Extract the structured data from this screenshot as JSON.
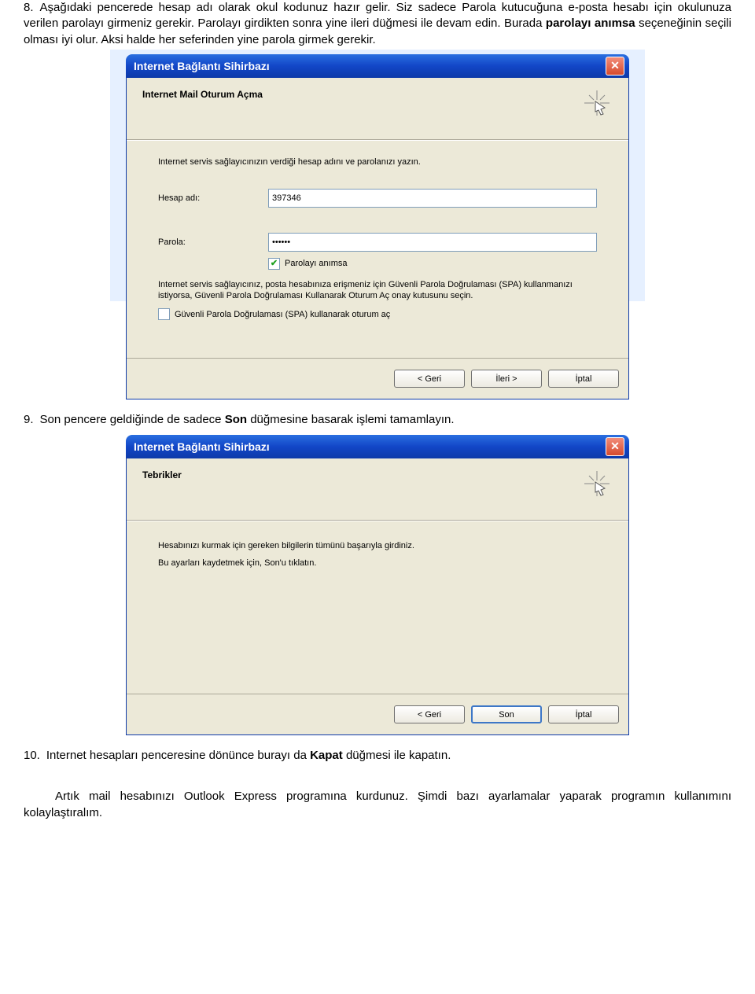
{
  "text": {
    "p8_num": "8.",
    "p8": "Aşağıdaki pencerede hesap adı olarak okul kodunuz hazır gelir. Siz sadece Parola kutucuğuna e-posta hesabı için okulunuza verilen parolayı girmeniz gerekir. Parolayı girdikten sonra yine ileri düğmesi ile devam edin. Burada ",
    "p8_bold1": "parolayı anımsa",
    "p8_cont": " seçeneğinin seçili olması iyi olur. Aksi halde her seferinden yine parola girmek gerekir.",
    "p9_num": "9.",
    "p9_a": "Son pencere geldiğinde de sadece ",
    "p9_bold": "Son",
    "p9_b": " düğmesine basarak işlemi tamamlayın.",
    "p10_num": "10.",
    "p10_a": "Internet hesapları penceresine dönünce burayı da ",
    "p10_bold": "Kapat",
    "p10_b": " düğmesi ile kapatın.",
    "pfinal": "Artık mail hesabınızı Outlook Express programına kurdunuz. Şimdi bazı ayarlamalar yaparak programın kullanımını kolaylaştıralım."
  },
  "dlg1": {
    "title": "Internet Bağlantı Sihirbazı",
    "header": "Internet Mail Oturum Açma",
    "intro": "Internet servis sağlayıcınızın verdiği hesap adını ve parolanızı yazın.",
    "acct_label": "Hesap adı:",
    "acct_value": "397346",
    "pw_label": "Parola:",
    "pw_value": "••••••",
    "cb_remember": "Parolayı anımsa",
    "spa_info": "Internet servis sağlayıcınız, posta hesabınıza erişmeniz için Güvenli Parola Doğrulaması (SPA) kullanmanızı istiyorsa, Güvenli Parola Doğrulaması Kullanarak Oturum Aç onay kutusunu seçin.",
    "cb_spa": "Güvenli Parola Doğrulaması (SPA) kullanarak oturum aç",
    "btn_back": "< Geri",
    "btn_next": "İleri >",
    "btn_cancel": "İptal"
  },
  "dlg2": {
    "title": "Internet Bağlantı Sihirbazı",
    "header": "Tebrikler",
    "line1": "Hesabınızı kurmak için gereken bilgilerin tümünü başarıyla girdiniz.",
    "line2": "Bu ayarları kaydetmek için, Son'u tıklatın.",
    "btn_back": "< Geri",
    "btn_finish": "Son",
    "btn_cancel": "İptal"
  }
}
